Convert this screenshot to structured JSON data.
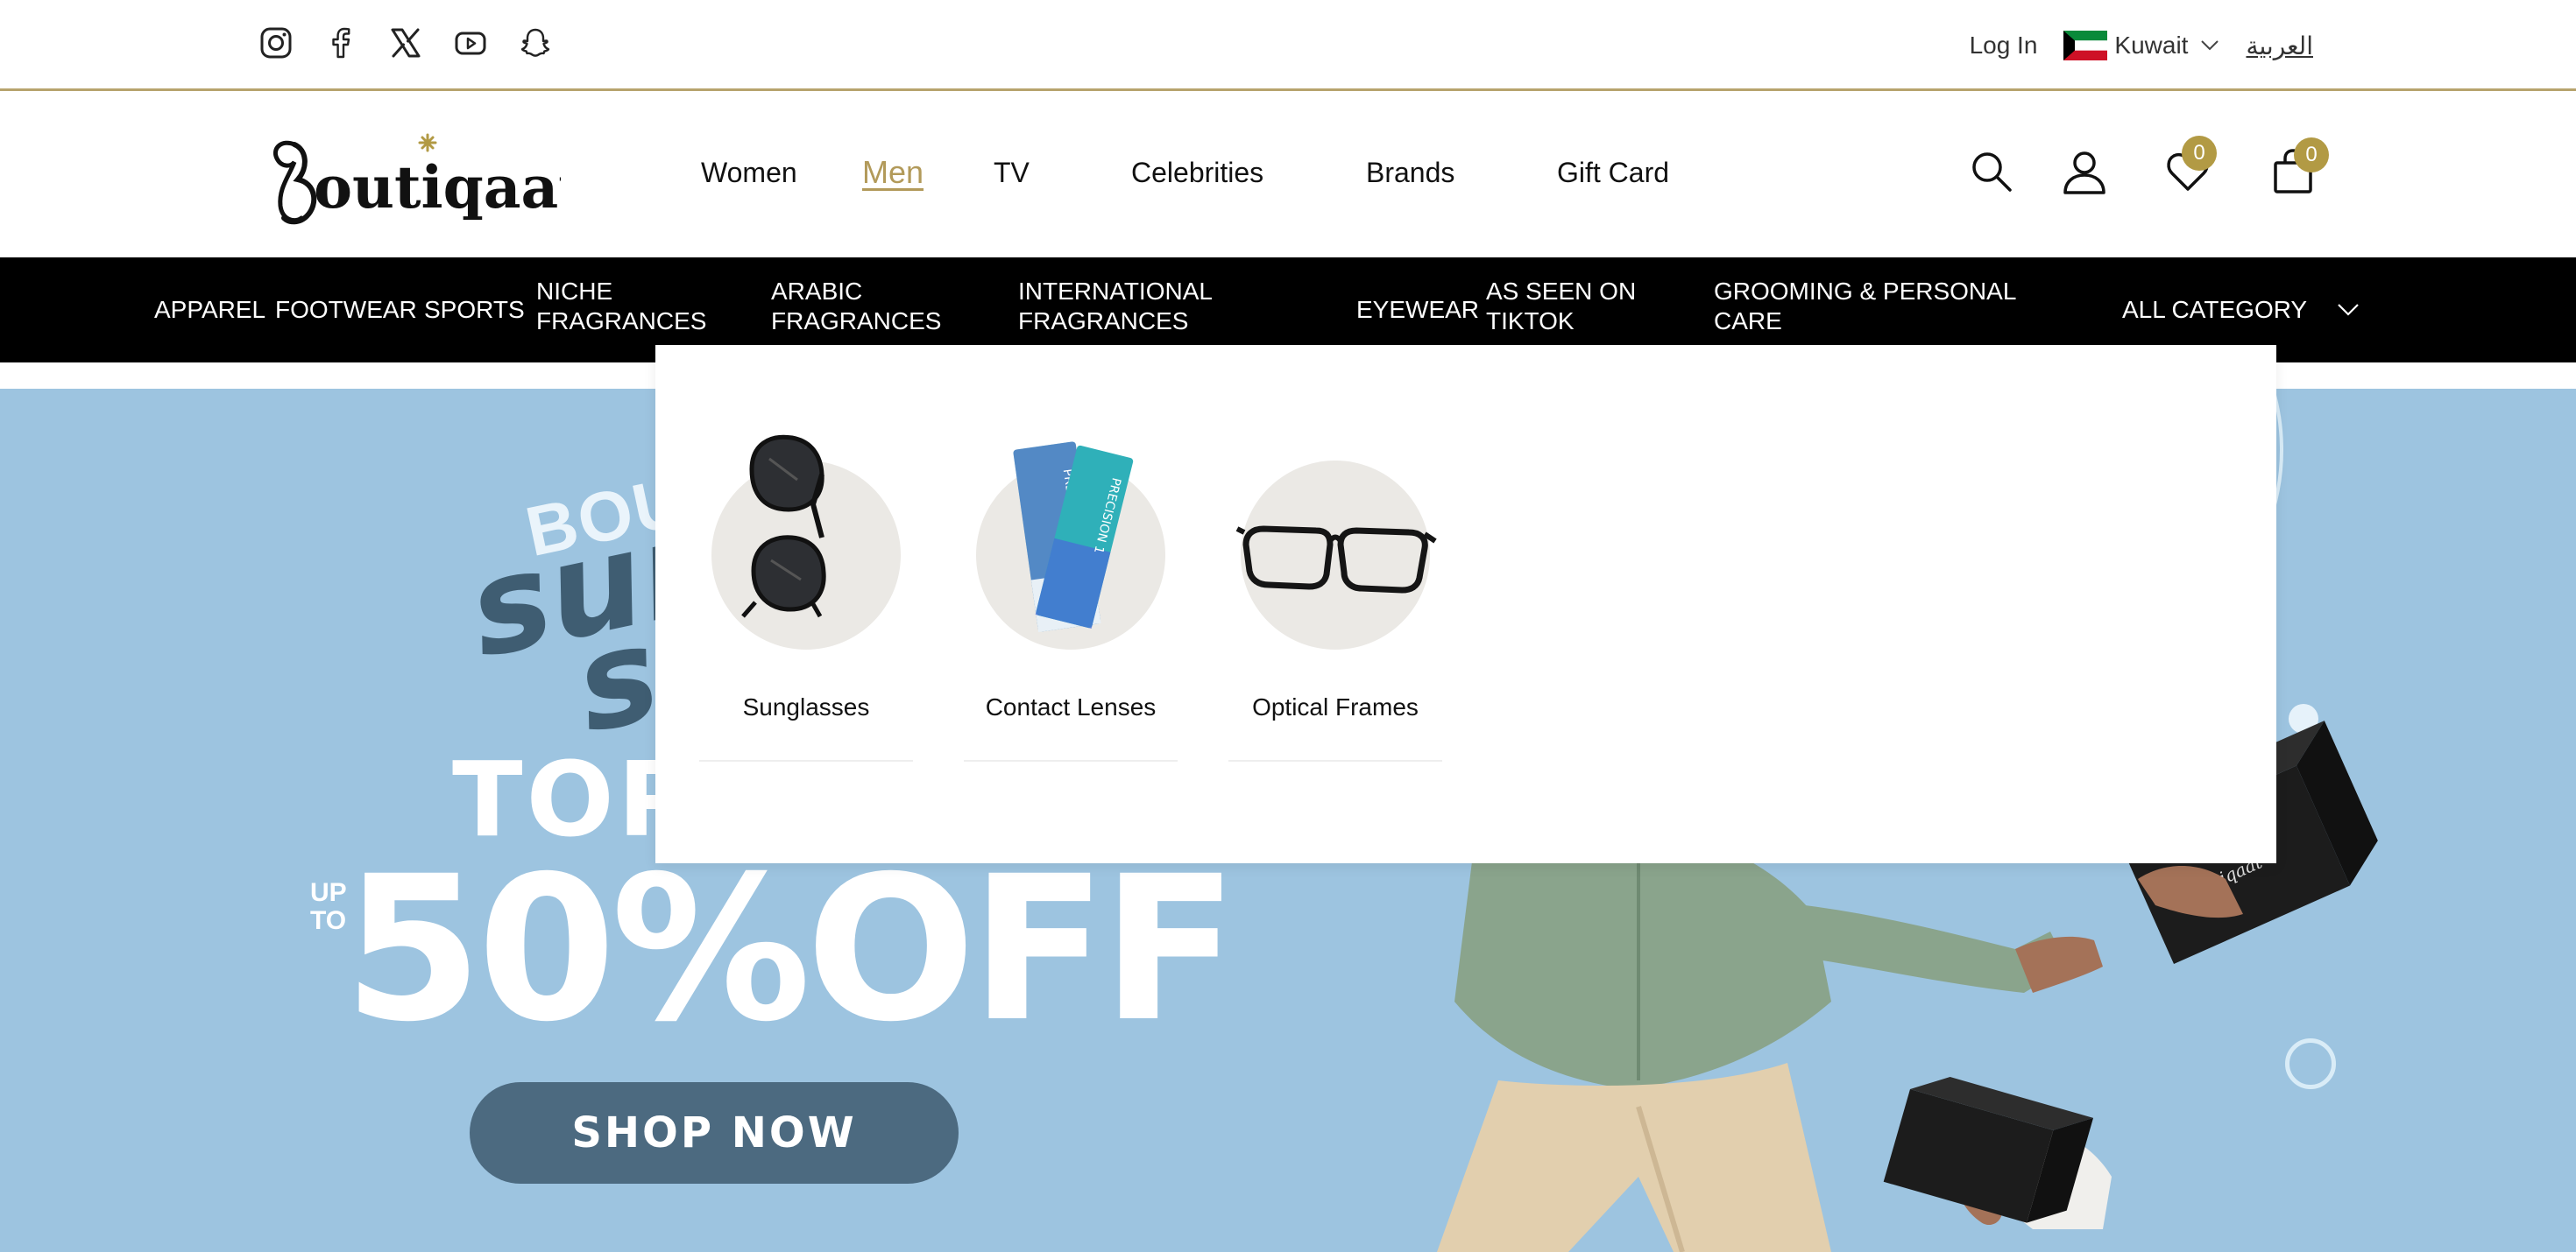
{
  "topbar": {
    "social_icons": [
      "instagram-icon",
      "facebook-icon",
      "x-icon",
      "youtube-icon",
      "snapchat-icon"
    ],
    "login_label": "Log In",
    "country_label": "Kuwait",
    "language_label": "العربية"
  },
  "header": {
    "logo_text": "Boutiqaat",
    "nav": [
      "Women",
      "Men",
      "TV",
      "Celebrities",
      "Brands",
      "Gift Card"
    ],
    "active_nav": "Men",
    "wishlist_count": "0",
    "cart_count": "0"
  },
  "categories": {
    "apparel": "APPAREL",
    "footwear": "FOOTWEAR",
    "sports": "SPORTS",
    "niche_1": "NICHE",
    "niche_2": "FRAGRANCES",
    "arabic_1": "ARABIC",
    "arabic_2": "FRAGRANCES",
    "intl_1": "INTERNATIONAL",
    "intl_2": "FRAGRANCES",
    "eyewear": "EYEWEAR",
    "tiktok_1": "AS SEEN ON",
    "tiktok_2": "TIKTOK",
    "grooming_1": "GROOMING & PERSONAL",
    "grooming_2": "CARE",
    "all_category": "ALL CATEGORY"
  },
  "dropdown": {
    "items": [
      {
        "label": "Sunglasses",
        "icon": "sunglasses-icon"
      },
      {
        "label": "Contact Lenses",
        "icon": "contact-lenses-icon"
      },
      {
        "label": "Optical Frames",
        "icon": "optical-frames-icon"
      }
    ]
  },
  "hero": {
    "brand_partial": "BOU",
    "script_partial_1": "sun",
    "script_partial_2": "s",
    "headline_partial": "TOP",
    "upto_1": "UP",
    "upto_2": "TO",
    "offer": "50%OFF",
    "cta_label": "SHOP NOW"
  },
  "colors": {
    "accent_gold": "#b29a5a",
    "badge_gold": "#b29a44",
    "category_bar": "#000000",
    "hero_background": "#9dc4e0",
    "cta_button": "#4c6a80"
  }
}
